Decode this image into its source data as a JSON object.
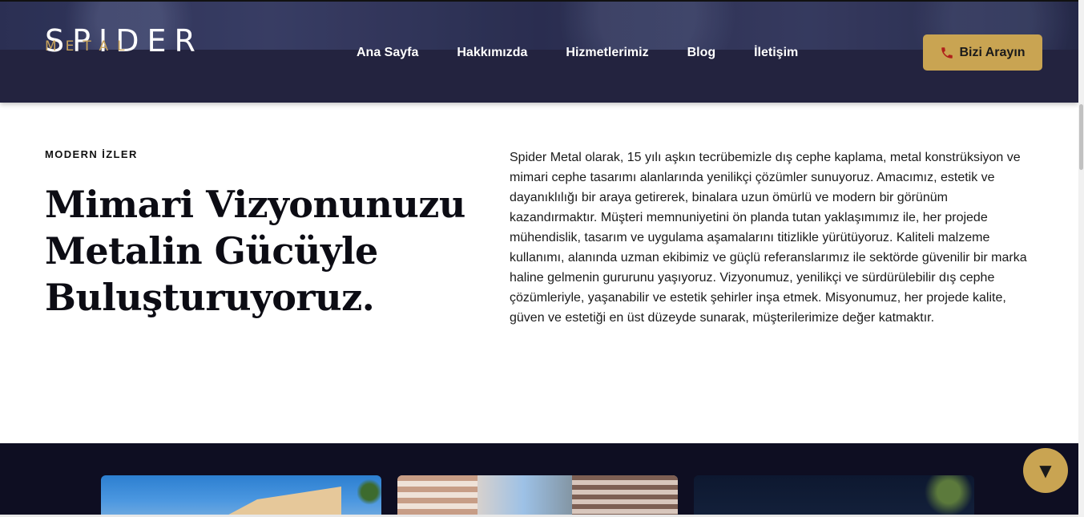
{
  "brand": {
    "name": "SPIDER",
    "sub": "METAL"
  },
  "nav": {
    "items": [
      {
        "label": "Ana Sayfa"
      },
      {
        "label": "Hakkımızda"
      },
      {
        "label": "Hizmetlerimiz"
      },
      {
        "label": "Blog"
      },
      {
        "label": "İletişim"
      }
    ],
    "cta_label": "Bizi Arayın",
    "cta_icon": "phone-icon"
  },
  "intro": {
    "eyebrow": "MODERN İZLER",
    "headline": [
      "Mimari Vizyonunuzu",
      "Metalin Gücüyle",
      "Buluşturuyoruz."
    ],
    "paragraph": "Spider Metal olarak, 15 yılı aşkın tecrübemizle dış cephe kaplama, metal konstrüksiyon ve mimari cephe tasarımı alanlarında yenilikçi çözümler sunuyoruz. Amacımız, estetik ve dayanıklılığı bir araya getirerek, binalara uzun ömürlü ve modern bir görünüm kazandırmaktır. Müşteri memnuniyetini ön planda tutan yaklaşımımız ile, her projede mühendislik, tasarım ve uygulama aşamalarını titizlikle yürütüyoruz. Kaliteli malzeme kullanımı, alanında uzman ekibimiz ve güçlü referanslarımız ile sektörde güvenilir bir marka haline gelmenin gururunu yaşıyoruz. Vizyonumuz, yenilikçi ve sürdürülebilir dış cephe çözümleriyle, yaşanabilir ve estetik şehirler inşa etmek. Misyonumuz, her projede kalite, güven ve estetiği en üst düzeyde sunarak, müşterilerimize değer katmaktır."
  },
  "scroll_button": {
    "icon": "arrow-down-icon",
    "glyph": "▼"
  },
  "colors": {
    "navy": "#23233f",
    "gold": "#c9a452",
    "dark_band": "#0e0e22"
  }
}
